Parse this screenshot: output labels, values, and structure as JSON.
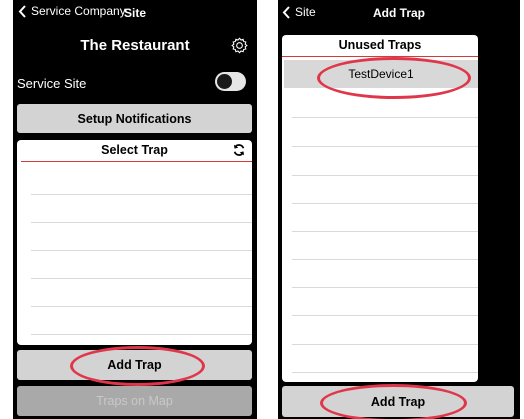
{
  "left_screen": {
    "nav": {
      "back_label": "Service Company",
      "title": "Site"
    },
    "page_title": "The Restaurant",
    "service_site": {
      "label": "Service Site",
      "enabled": false
    },
    "setup_notifications_label": "Setup Notifications",
    "select_trap": {
      "header": "Select Trap",
      "rows": [
        "",
        "",
        "",
        "",
        "",
        "",
        ""
      ]
    },
    "add_trap_label": "Add Trap",
    "traps_on_map_label": "Traps on Map"
  },
  "right_screen": {
    "nav": {
      "back_label": "Site",
      "title": "Add Trap"
    },
    "unused_traps": {
      "header": "Unused Traps",
      "rows": [
        "TestDevice1",
        "",
        "",
        "",
        "",
        "",
        "",
        "",
        "",
        "",
        ""
      ]
    },
    "add_trap_label": "Add Trap"
  },
  "highlights": {
    "color": "#e0364a",
    "circled": [
      "Add Trap",
      "TestDevice1",
      "Add Trap"
    ]
  },
  "colors": {
    "screen_background": "#000000",
    "button_gray": "#d3d3d3",
    "button_disabled": "#a9a9a9",
    "header_rule": "#d33a3a",
    "selected_row": "#d8d8d8"
  }
}
